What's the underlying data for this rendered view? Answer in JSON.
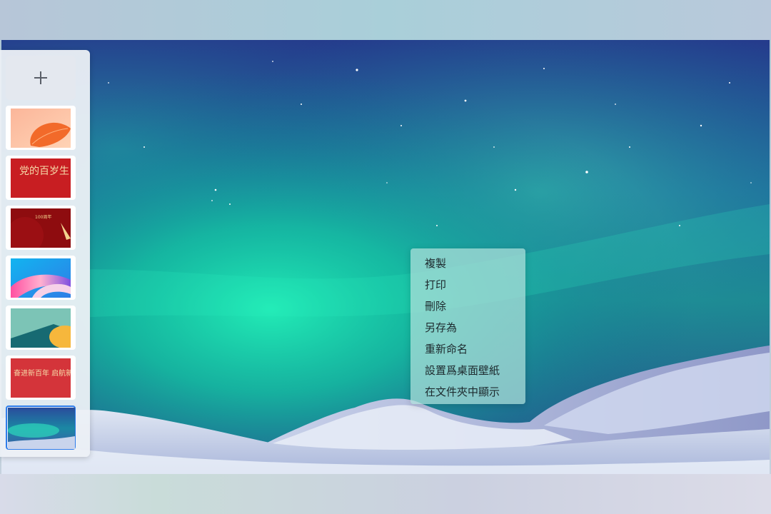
{
  "panel": {
    "add_button_label": "+",
    "thumbnails": [
      {
        "name": "orange-petal-wallpaper",
        "selected": false
      },
      {
        "name": "red-calligraphy-wallpaper",
        "selected": false,
        "text": "党的百岁生日"
      },
      {
        "name": "dark-red-anniversary-wallpaper",
        "selected": false,
        "text": "100周年"
      },
      {
        "name": "colorful-ribbon-wallpaper",
        "selected": false
      },
      {
        "name": "teal-yellow-abstract-wallpaper",
        "selected": false
      },
      {
        "name": "red-slogan-wallpaper",
        "selected": false,
        "text": "奋进新百年 启航新征程"
      },
      {
        "name": "aurora-wallpaper",
        "selected": true
      }
    ]
  },
  "context_menu": {
    "items": [
      {
        "id": "copy",
        "label": "複製"
      },
      {
        "id": "print",
        "label": "打印"
      },
      {
        "id": "delete",
        "label": "刪除"
      },
      {
        "id": "save-as",
        "label": "另存為"
      },
      {
        "id": "rename",
        "label": "重新命名"
      },
      {
        "id": "set-wallpaper",
        "label": "設置爲桌面壁紙"
      },
      {
        "id": "show-in-folder",
        "label": "在文件夾中顯示"
      }
    ]
  },
  "colors": {
    "selection_border": "#2f7dea",
    "aurora_green": "#19e0b0",
    "sky_dark": "#1f3f8a"
  }
}
